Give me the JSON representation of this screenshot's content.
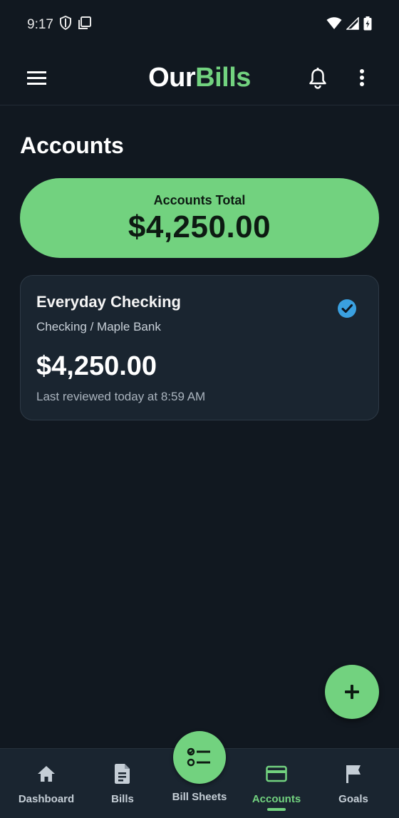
{
  "status_bar": {
    "time": "9:17"
  },
  "app_bar": {
    "logo_part1": "Our",
    "logo_part2": "Bills"
  },
  "page": {
    "title": "Accounts"
  },
  "total": {
    "label": "Accounts Total",
    "value": "$4,250.00"
  },
  "accounts": [
    {
      "name": "Everyday Checking",
      "subtitle": "Checking / Maple Bank",
      "balance": "$4,250.00",
      "reviewed": "Last reviewed today at 8:59 AM",
      "selected": true
    }
  ],
  "bottom_nav": {
    "items": [
      {
        "label": "Dashboard",
        "icon": "home-icon"
      },
      {
        "label": "Bills",
        "icon": "document-icon"
      },
      {
        "label": "Bill Sheets",
        "icon": "checklist-icon"
      },
      {
        "label": "Accounts",
        "icon": "credit-card-icon",
        "active": true
      },
      {
        "label": "Goals",
        "icon": "flag-icon"
      }
    ]
  },
  "colors": {
    "background": "#111820",
    "accent": "#72d27f",
    "card": "#1a2530",
    "check_badge": "#3aa0e0"
  }
}
